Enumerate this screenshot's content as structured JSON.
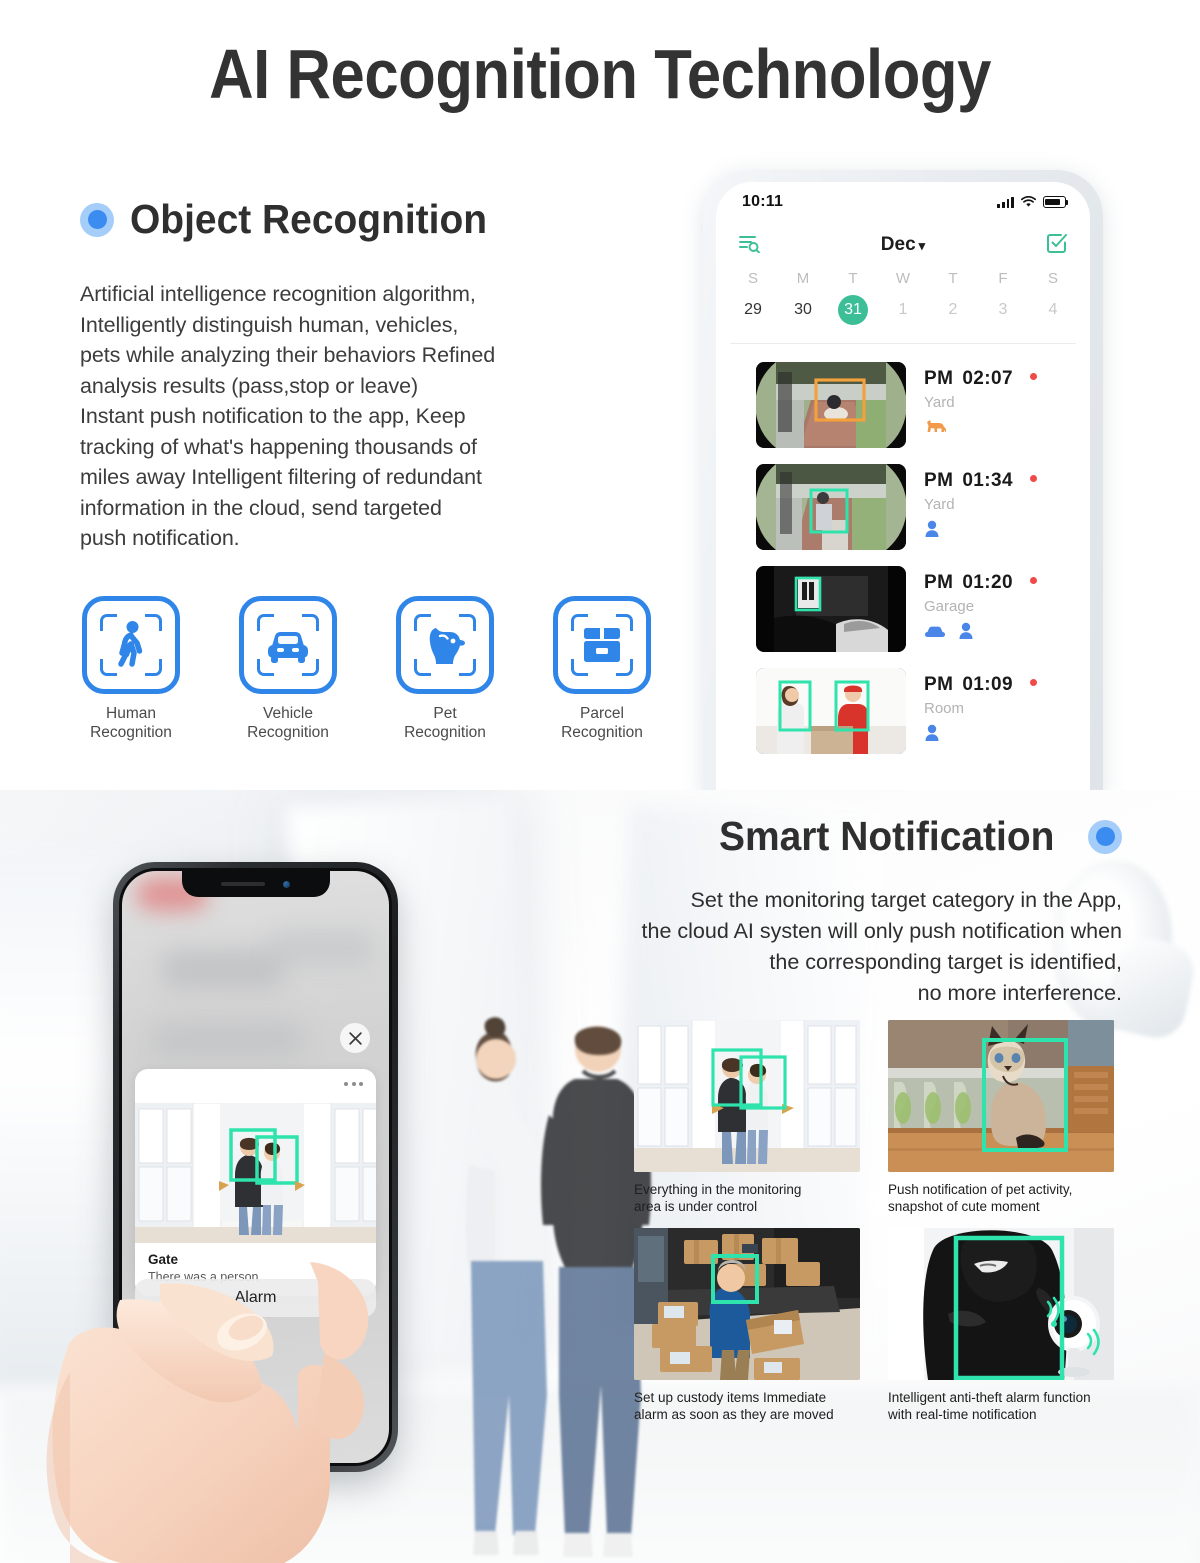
{
  "page": {
    "title": "AI Recognition Technology"
  },
  "object_recognition": {
    "heading": "Object Recognition",
    "bullet_color": "#3b8cf0",
    "body": "Artificial intelligence recognition algorithm,\nIntelligently distinguish human, vehicles,\npets while analyzing their behaviors Refined\nanalysis  results (pass,stop or leave)\nInstant push notification to the app, Keep\ntracking of what's happening thousands of\nmiles away Intelligent filtering of redundant\ninformation in the cloud, send targeted\npush notification.",
    "features": [
      {
        "icon": "human-walking-icon",
        "label": "Human\nRecognition"
      },
      {
        "icon": "car-icon",
        "label": "Vehicle\nRecognition"
      },
      {
        "icon": "dog-head-icon",
        "label": "Pet\nRecognition"
      },
      {
        "icon": "parcel-box-icon",
        "label": "Parcel\nRecognition"
      }
    ],
    "accent_color": "#2f86e8"
  },
  "phone_app": {
    "status_bar": {
      "time": "10:11",
      "signal_icon": "signal-bars-icon",
      "wifi_icon": "wifi-icon",
      "battery_icon": "battery-icon"
    },
    "app_bar": {
      "filter_icon": "filter-search-icon",
      "month": "Dec",
      "caret": "▾",
      "select_icon": "checkbox-select-icon",
      "accent_color": "#3cbf96"
    },
    "calendar": {
      "weekdays": [
        "S",
        "M",
        "T",
        "W",
        "T",
        "F",
        "S"
      ],
      "days": [
        {
          "num": "29",
          "state": "normal",
          "dot": false
        },
        {
          "num": "30",
          "state": "normal",
          "dot": true
        },
        {
          "num": "31",
          "state": "active",
          "dot": true
        },
        {
          "num": "1",
          "state": "muted",
          "dot": false
        },
        {
          "num": "2",
          "state": "muted",
          "dot": false
        },
        {
          "num": "3",
          "state": "muted",
          "dot": false
        },
        {
          "num": "4",
          "state": "muted",
          "dot": false
        }
      ]
    },
    "events": [
      {
        "ampm": "PM",
        "time": "02:07",
        "place": "Yard",
        "tags": [
          "dog-icon"
        ],
        "unread": true,
        "thumb": "yard-dog-daytime"
      },
      {
        "ampm": "PM",
        "time": "01:34",
        "place": "Yard",
        "tags": [
          "person-icon"
        ],
        "unread": true,
        "thumb": "yard-person-daytime"
      },
      {
        "ampm": "PM",
        "time": "01:20",
        "place": "Garage",
        "tags": [
          "car-icon",
          "person-icon"
        ],
        "unread": true,
        "thumb": "garage-night-bw"
      },
      {
        "ampm": "PM",
        "time": "01:09",
        "place": "Room",
        "tags": [
          "person-icon"
        ],
        "unread": true,
        "thumb": "room-delivery"
      }
    ]
  },
  "smart_notification": {
    "heading": "Smart Notification",
    "bullet_color": "#3b8cf0",
    "body": "Set the monitoring target category in the App,\nthe cloud AI systen will only push notification when\nthe corresponding target is identified,\nno more interference.",
    "tiles": [
      {
        "caption": "Everything in the monitoring\narea is under control",
        "image": "couple-entering-doorway"
      },
      {
        "caption": "Push notification of pet activity,\nsnapshot of cute moment",
        "image": "siamese-cat-on-table"
      },
      {
        "caption": "Set up custody items Immediate\nalarm as soon as they are moved",
        "image": "delivery-man-with-packages"
      },
      {
        "caption": "Intelligent anti-theft alarm function\nwith real-time notification",
        "image": "masked-intruder-with-camera"
      }
    ],
    "detection_color": "#2ee3ac"
  },
  "phone_notification": {
    "close_icon": "close-icon",
    "more_icon": "more-dots-icon",
    "title": "Gate",
    "subtitle": "There was a person",
    "alarm_label": "Alarm"
  }
}
